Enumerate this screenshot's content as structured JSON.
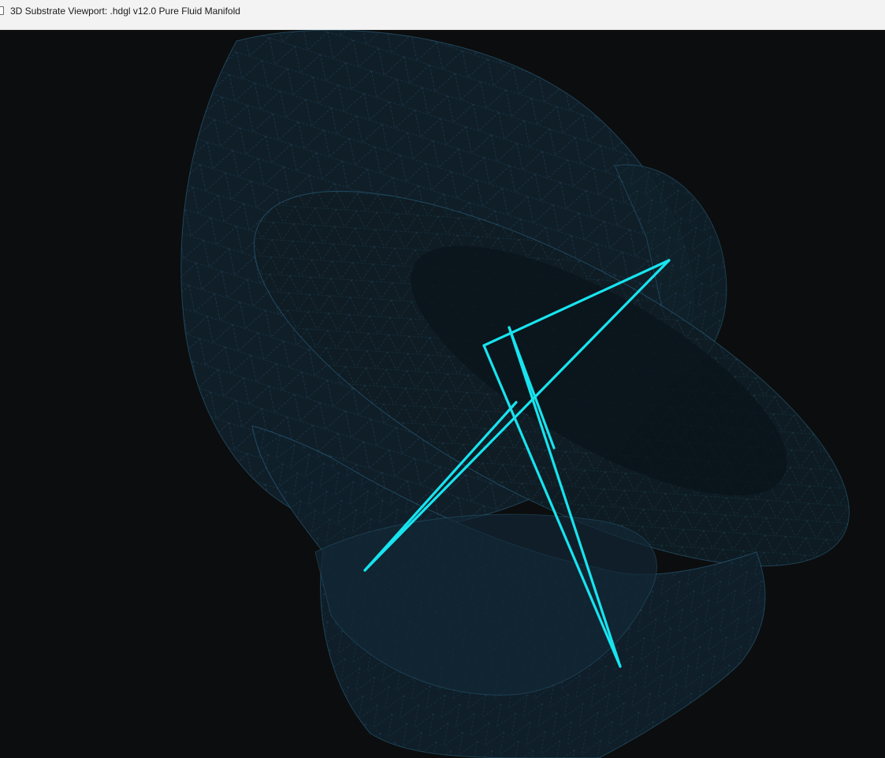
{
  "window": {
    "title": "3D Substrate Viewport: .hdgl v12.0 Pure Fluid Manifold",
    "icon": "document-icon"
  },
  "viewport": {
    "background_color": "#0c0d0e",
    "mesh_color": "#4fb6e6",
    "mesh_fill_color": "#12212b",
    "trajectory_color": "#18e4ef"
  }
}
